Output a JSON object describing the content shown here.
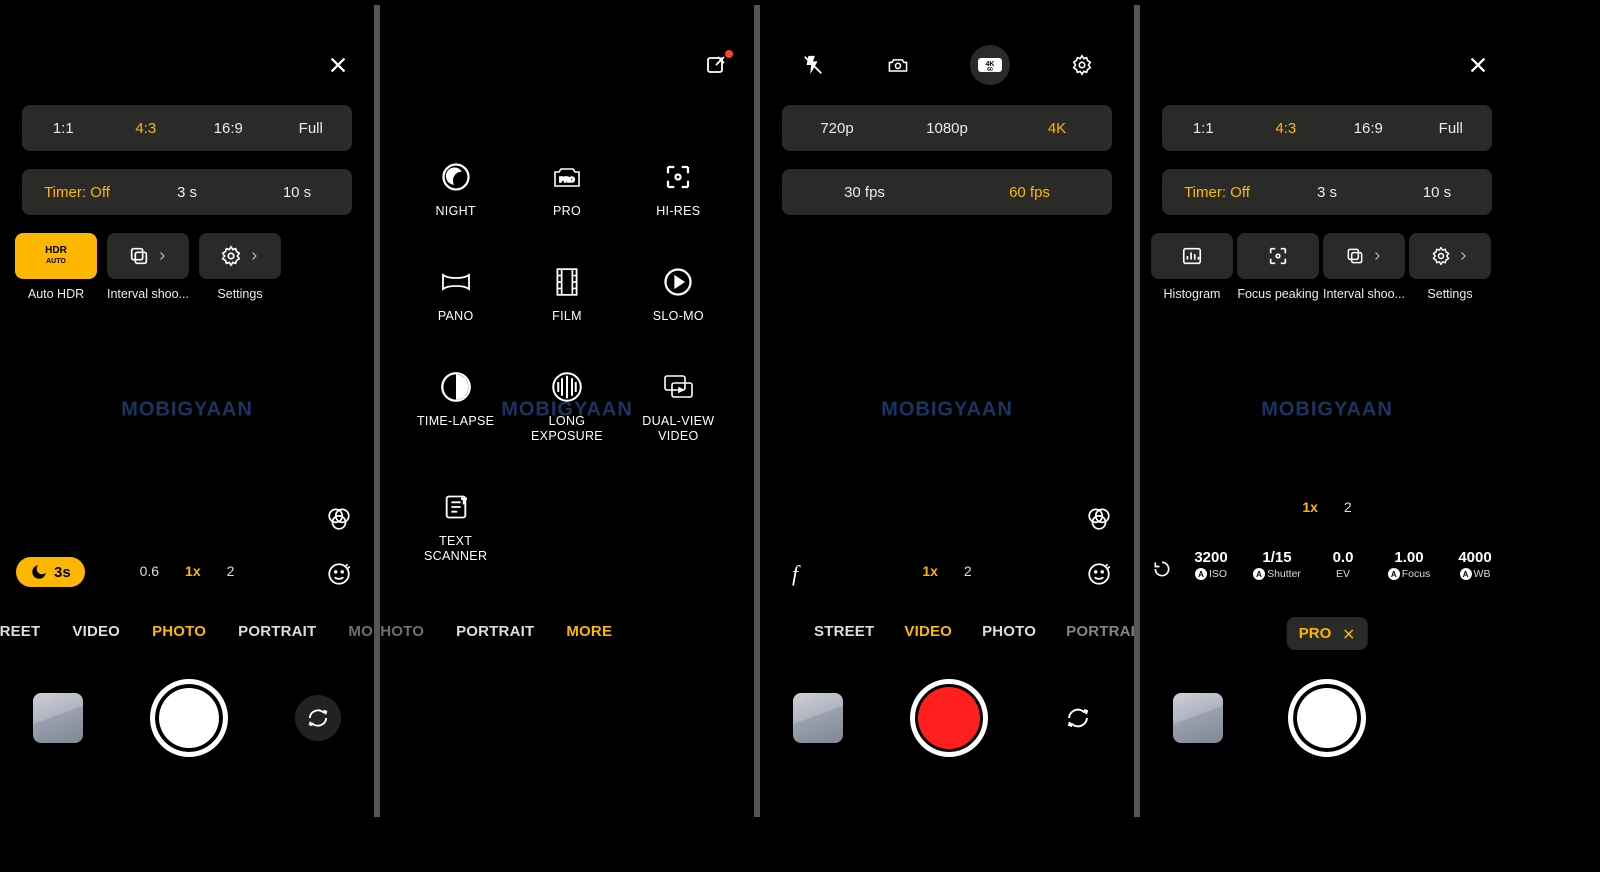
{
  "screen1": {
    "ratios": [
      "1:1",
      "4:3",
      "16:9",
      "Full"
    ],
    "ratio_active": 1,
    "timers": [
      "Timer: Off",
      "3 s",
      "10 s"
    ],
    "timer_active": 0,
    "tiles": [
      {
        "label": "Auto HDR",
        "active": true,
        "icon": "hdr-auto"
      },
      {
        "label": "Interval shoo...",
        "active": false,
        "icon": "stack",
        "chevron": true
      },
      {
        "label": "Settings",
        "active": false,
        "icon": "gear",
        "chevron": true
      }
    ],
    "night_pill": "3s",
    "zooms": [
      "0.6",
      "1x",
      "2"
    ],
    "zoom_active": 1,
    "modes": [
      "STREET",
      "VIDEO",
      "PHOTO",
      "PORTRAIT",
      "MORE"
    ],
    "mode_active": 2
  },
  "screen2": {
    "grid": [
      "NIGHT",
      "PRO",
      "HI-RES",
      "PANO",
      "FILM",
      "SLO-MO",
      "TIME-LAPSE",
      "LONG\nEXPOSURE",
      "DUAL-VIEW\nVIDEO",
      "TEXT\nSCANNER"
    ],
    "modes": [
      "PHOTO",
      "PORTRAIT",
      "MORE"
    ],
    "mode_active": 2
  },
  "screen3": {
    "res": [
      "720p",
      "1080p",
      "4K"
    ],
    "res_active": 2,
    "fps": [
      "30 fps",
      "60 fps"
    ],
    "fps_active": 1,
    "top_active_label": "4K60",
    "zooms": [
      "1x",
      "2"
    ],
    "zoom_active": 0,
    "modes": [
      "STREET",
      "VIDEO",
      "PHOTO",
      "PORTRAIT"
    ],
    "mode_active": 1
  },
  "screen4": {
    "ratios": [
      "1:1",
      "4:3",
      "16:9",
      "Full"
    ],
    "ratio_active": 1,
    "timers": [
      "Timer: Off",
      "3 s",
      "10 s"
    ],
    "timer_active": 0,
    "tiles": [
      {
        "label": "Histogram",
        "icon": "histogram"
      },
      {
        "label": "Focus peaking",
        "icon": "focus"
      },
      {
        "label": "Interval shoo...",
        "icon": "stack",
        "chevron": true
      },
      {
        "label": "Settings",
        "icon": "gear",
        "chevron": true
      }
    ],
    "zooms": [
      "1x",
      "2"
    ],
    "zoom_active": 0,
    "params": [
      {
        "v": "3200",
        "k": "ISO",
        "auto": true
      },
      {
        "v": "1/15",
        "k": "Shutter",
        "auto": true
      },
      {
        "v": "0.0",
        "k": "EV",
        "auto": false
      },
      {
        "v": "1.00",
        "k": "Focus",
        "auto": true
      },
      {
        "v": "4000",
        "k": "WB",
        "auto": true
      }
    ],
    "mode_chip": "PRO"
  }
}
